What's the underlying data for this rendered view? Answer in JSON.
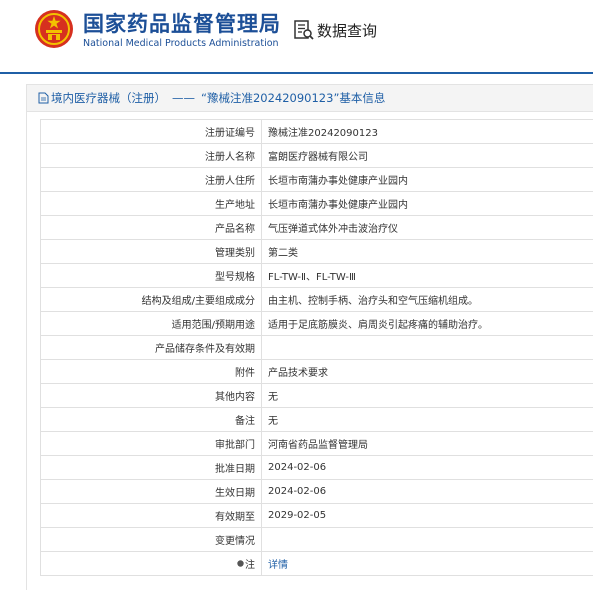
{
  "header": {
    "org_name_cn": "国家药品监督管理局",
    "org_name_en": "National Medical Products Administration",
    "query_label": "数据查询",
    "query_icon": "search-document-icon",
    "emblem_icon": "national-emblem-icon",
    "brand_color": "#1c4f97"
  },
  "panel": {
    "doc_icon": "document-icon",
    "category": "境内医疗器械（注册）",
    "separator": "——",
    "record_title": "“豫械注准20242090123”基本信息"
  },
  "rows": [
    {
      "label": "注册证编号",
      "value": "豫械注准20242090123"
    },
    {
      "label": "注册人名称",
      "value": "富朗医疗器械有限公司"
    },
    {
      "label": "注册人住所",
      "value": "长垣市南蒲办事处健康产业园内"
    },
    {
      "label": "生产地址",
      "value": "长垣市南蒲办事处健康产业园内"
    },
    {
      "label": "产品名称",
      "value": "气压弹道式体外冲击波治疗仪"
    },
    {
      "label": "管理类别",
      "value": "第二类"
    },
    {
      "label": "型号规格",
      "value": "FL-TW-Ⅱ、FL-TW-Ⅲ"
    },
    {
      "label": "结构及组成/主要组成成分",
      "value": "由主机、控制手柄、治疗头和空气压缩机组成。"
    },
    {
      "label": "适用范围/预期用途",
      "value": "适用于足底筋膜炎、肩周炎引起疼痛的辅助治疗。"
    },
    {
      "label": "产品储存条件及有效期",
      "value": ""
    },
    {
      "label": "附件",
      "value": "产品技术要求"
    },
    {
      "label": "其他内容",
      "value": "无"
    },
    {
      "label": "备注",
      "value": "无"
    },
    {
      "label": "审批部门",
      "value": "河南省药品监督管理局"
    },
    {
      "label": "批准日期",
      "value": "2024-02-06"
    },
    {
      "label": "生效日期",
      "value": "2024-02-06"
    },
    {
      "label": "有效期至",
      "value": "2029-02-05"
    },
    {
      "label": "变更情况",
      "value": ""
    }
  ],
  "note_row": {
    "label": "注",
    "icon": "info-dot-icon",
    "link_text": "详情"
  }
}
